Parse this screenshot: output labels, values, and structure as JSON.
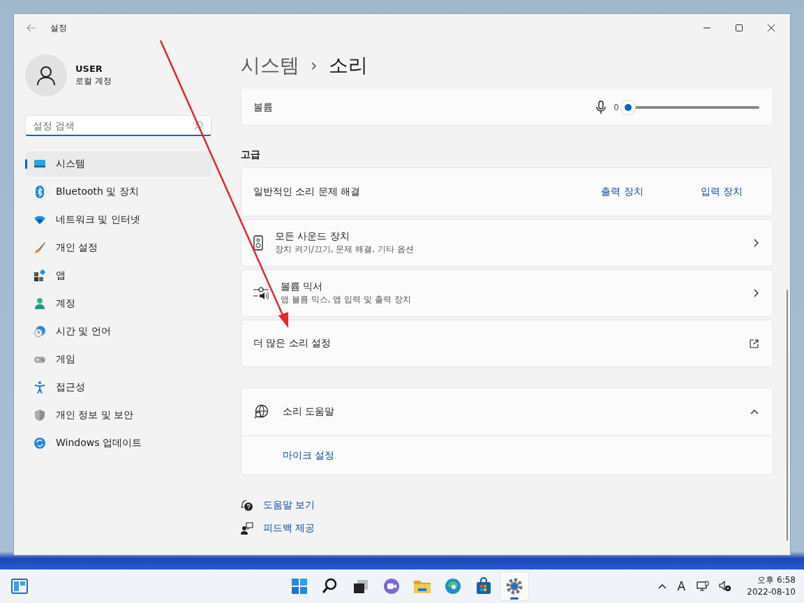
{
  "window": {
    "title": "설정"
  },
  "profile": {
    "name": "USER",
    "account_type": "로컬 계정"
  },
  "search": {
    "placeholder": "설정 검색"
  },
  "sidebar": {
    "items": [
      {
        "label": "시스템",
        "selected": true
      },
      {
        "label": "Bluetooth 및 장치",
        "selected": false
      },
      {
        "label": "네트워크 및 인터넷",
        "selected": false
      },
      {
        "label": "개인 설정",
        "selected": false
      },
      {
        "label": "앱",
        "selected": false
      },
      {
        "label": "계정",
        "selected": false
      },
      {
        "label": "시간 및 언어",
        "selected": false
      },
      {
        "label": "게임",
        "selected": false
      },
      {
        "label": "접근성",
        "selected": false
      },
      {
        "label": "개인 정보 및 보안",
        "selected": false
      },
      {
        "label": "Windows 업데이트",
        "selected": false
      }
    ]
  },
  "breadcrumb": {
    "parent": "시스템",
    "separator": "›",
    "current": "소리"
  },
  "input_volume": {
    "label": "볼륨",
    "reading": "0",
    "level": 0
  },
  "section_heading": "고급",
  "troubleshoot": {
    "label": "일반적인 소리 문제 해결",
    "links": [
      "출력 장치",
      "입력 장치"
    ]
  },
  "setting_cards": [
    {
      "kind": "chevron",
      "title": "모든 사운드 장치",
      "subtitle": "장치 켜기/끄기, 문제 해결, 기타 옵션"
    },
    {
      "kind": "chevron",
      "title": "볼륨 믹서",
      "subtitle": "앱 볼륨 믹스, 앱 입력 및 출력 장치"
    },
    {
      "kind": "external",
      "title": "더 많은 소리 설정"
    }
  ],
  "help": {
    "title": "소리 도움말",
    "expanded": true,
    "links": [
      "마이크 설정"
    ]
  },
  "footer_links": [
    "도움말 보기",
    "피드백 제공"
  ],
  "taskbar": {
    "apps": [
      {
        "selected": false
      },
      {
        "selected": false
      },
      {
        "selected": false
      },
      {
        "selected": false
      },
      {
        "selected": false
      },
      {
        "selected": false
      },
      {
        "selected": false
      },
      {
        "selected": true
      }
    ],
    "input_indicator": "A",
    "time": "오후 6:58",
    "date": "2022-08-10"
  }
}
